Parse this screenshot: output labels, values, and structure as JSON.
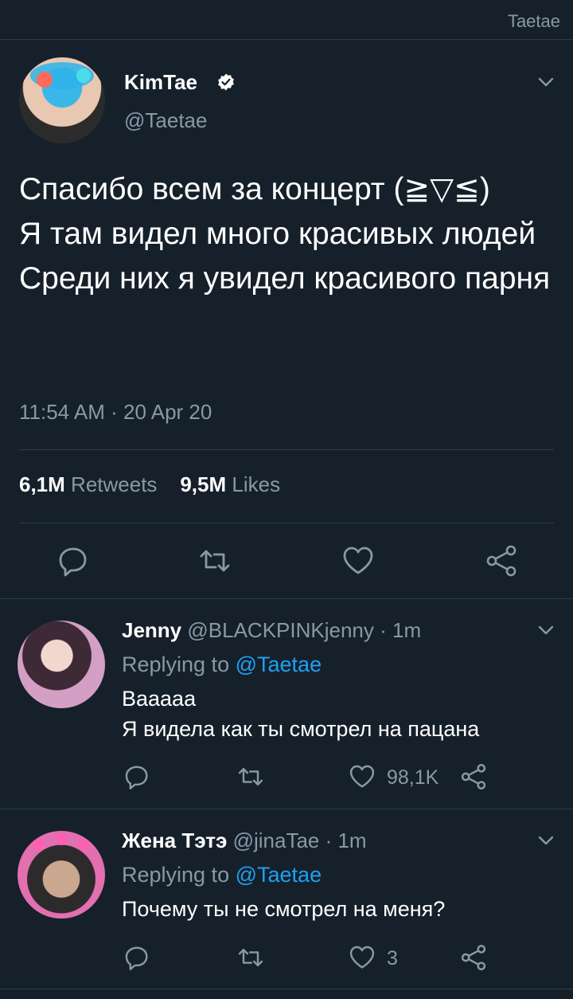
{
  "header": {
    "title": "Taetae"
  },
  "main_tweet": {
    "display_name": "KimTae",
    "handle": "@Taetae",
    "text": "Спасибо всем за концерт (≧▽≦)\nЯ там видел много красивых людей\nСреди них я увидел красивого парня",
    "timestamp": "11:54 AM · 20 Apr 20",
    "retweets_count": "6,1M",
    "retweets_label": "Retweets",
    "likes_count": "9,5M",
    "likes_label": "Likes"
  },
  "replies": [
    {
      "display_name": "Jenny",
      "handle_time": "@BLACKPINKjenny · 1m",
      "replying_prefix": "Replying to",
      "replying_to": "@Taetae",
      "text": "Вааааа\nЯ видела как ты смотрел на пацана",
      "likes": "98,1K"
    },
    {
      "display_name": "Жена Тэтэ",
      "handle_time": "@jinaTae · 1m",
      "replying_prefix": "Replying to",
      "replying_to": "@Taetae",
      "text": "Почему ты не смотрел на меня?",
      "likes": "3"
    }
  ],
  "colors": {
    "background": "#15202b",
    "accent": "#1da1f2",
    "secondary_text": "#8899a6",
    "divider": "#2f3c4a"
  },
  "icons": [
    "reply-icon",
    "retweet-icon",
    "like-icon",
    "share-icon",
    "chevron-down-icon",
    "verified-badge-icon"
  ]
}
